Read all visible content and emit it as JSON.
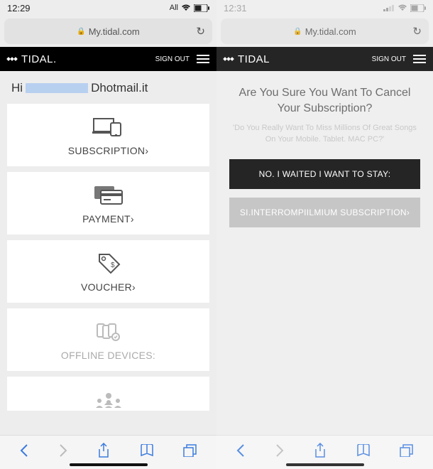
{
  "left": {
    "status": {
      "time": "12:29",
      "carrier": "All"
    },
    "url": "My.tidal.com",
    "brand": "TIDAL.",
    "sign_out": "SIGN OUT",
    "greeting_prefix": "Hi",
    "greeting_suffix": "Dhotmail.it",
    "cards": [
      {
        "label": "SUBSCRIPTION›"
      },
      {
        "label": "PAYMENT›"
      },
      {
        "label": "VOUCHER›"
      },
      {
        "label": "OFFLINE DEVICES:"
      }
    ]
  },
  "right": {
    "status": {
      "time": "12:31"
    },
    "url": "My.tidal.com",
    "brand": "TIDAL",
    "sign_out": "SIGN OUT",
    "heading": "Are You Sure You Want To Cancel Your Subscription?",
    "sub": "'Do You Really Want To Miss Millions Of Great Songs On Your Mobile. Tablet. MAC PC?'",
    "btn_primary": "NO. I WAITED I WANT TO STAY:",
    "btn_secondary": "SI.INTERROMPIILMIUM SUBSCRIPTION›"
  }
}
